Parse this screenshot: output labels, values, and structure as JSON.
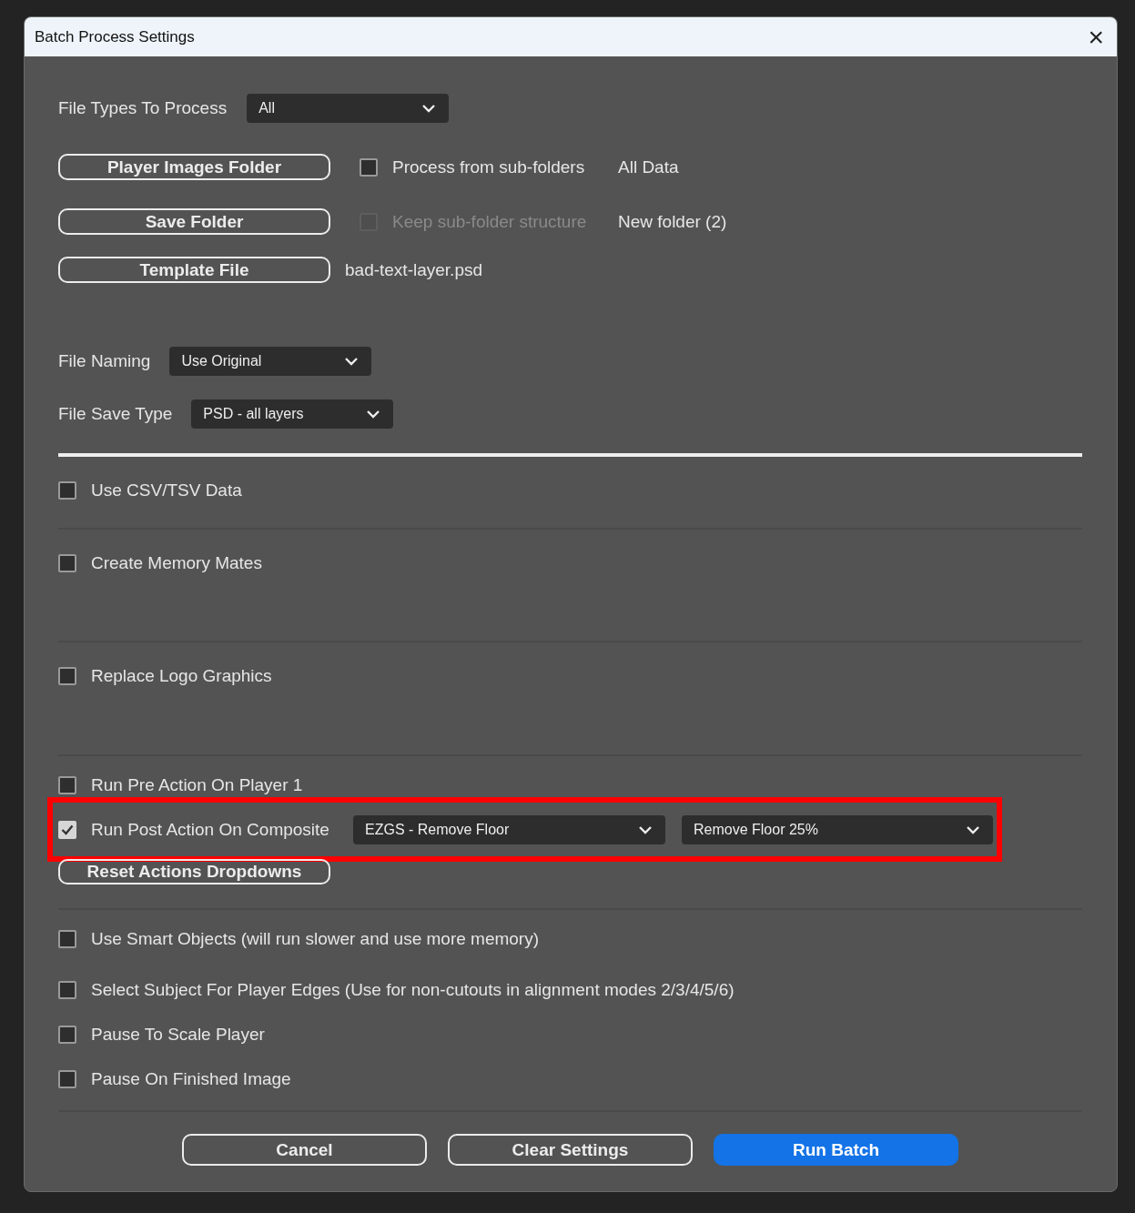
{
  "window": {
    "title": "Batch Process Settings",
    "close": "×"
  },
  "file_types": {
    "label": "File Types To Process",
    "value": "All"
  },
  "folder_rows": [
    {
      "button": "Player Images Folder",
      "option": {
        "label": "Process from sub-folders",
        "checked": false,
        "disabled": false
      },
      "path": "All Data"
    },
    {
      "button": "Save Folder",
      "option": {
        "label": "Keep sub-folder structure",
        "checked": false,
        "disabled": true
      },
      "path": "New folder (2)"
    },
    {
      "button": "Template File",
      "path": "bad-text-layer.psd"
    }
  ],
  "naming": [
    {
      "label": "File Naming",
      "value": "Use Original"
    },
    {
      "label": "File Save Type",
      "value": "PSD - all layers"
    }
  ],
  "sections": [
    {
      "items": [
        {
          "kind": "checkbox",
          "label": "Use CSV/TSV Data",
          "checked": false
        }
      ]
    },
    {
      "items": [
        {
          "kind": "checkbox",
          "label": "Create Memory Mates",
          "checked": false
        }
      ]
    },
    {
      "items": [
        {
          "kind": "checkbox",
          "label": "Replace Logo Graphics",
          "checked": false
        }
      ]
    },
    {
      "items": [
        {
          "kind": "checkbox",
          "label": "Run Pre Action On Player 1",
          "checked": false
        },
        {
          "kind": "action",
          "label": "Run Post Action On Composite",
          "checked": true,
          "highlighted": true,
          "set": "EZGS - Remove Floor",
          "action": "Remove Floor 25%"
        },
        {
          "kind": "button",
          "label": "Reset Actions Dropdowns"
        }
      ]
    },
    {
      "items": [
        {
          "kind": "checkbox",
          "label": "Use Smart Objects (will run slower and use more memory)",
          "checked": false
        },
        {
          "kind": "checkbox",
          "label": "Select Subject For Player Edges (Use for non-cutouts in alignment modes 2/3/4/5/6)",
          "checked": false
        },
        {
          "kind": "checkbox",
          "label": "Pause To Scale Player",
          "checked": false
        },
        {
          "kind": "checkbox",
          "label": "Pause On Finished Image",
          "checked": false
        }
      ]
    }
  ],
  "buttons": [
    {
      "label": "Cancel",
      "primary": false
    },
    {
      "label": "Clear Settings",
      "primary": false
    },
    {
      "label": "Run Batch",
      "primary": true
    }
  ]
}
